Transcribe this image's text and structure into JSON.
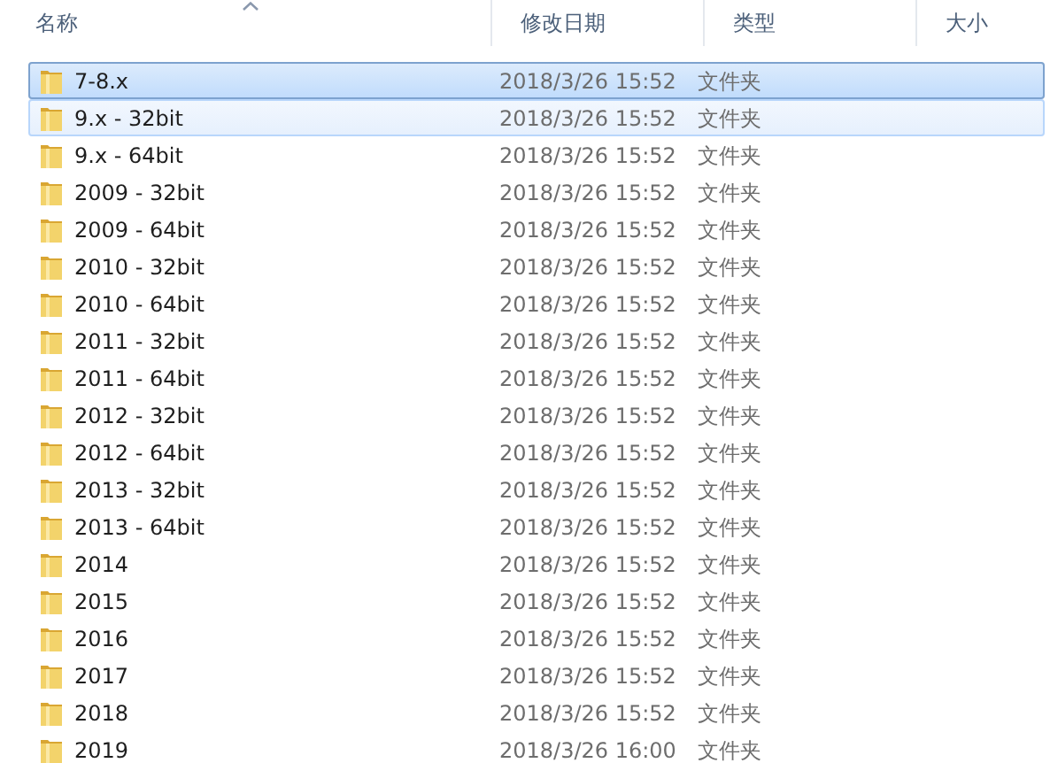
{
  "columns": [
    {
      "label": "名称",
      "sorted": true
    },
    {
      "label": "修改日期",
      "sorted": false
    },
    {
      "label": "类型",
      "sorted": false
    },
    {
      "label": "大小",
      "sorted": false
    }
  ],
  "rows": [
    {
      "name": "7-8.x",
      "date": "2018/3/26 15:52",
      "type": "文件夹",
      "selected": true,
      "hover": false
    },
    {
      "name": "9.x - 32bit",
      "date": "2018/3/26 15:52",
      "type": "文件夹",
      "selected": false,
      "hover": true
    },
    {
      "name": "9.x - 64bit",
      "date": "2018/3/26 15:52",
      "type": "文件夹",
      "selected": false,
      "hover": false
    },
    {
      "name": "2009 - 32bit",
      "date": "2018/3/26 15:52",
      "type": "文件夹",
      "selected": false,
      "hover": false
    },
    {
      "name": "2009 - 64bit",
      "date": "2018/3/26 15:52",
      "type": "文件夹",
      "selected": false,
      "hover": false
    },
    {
      "name": "2010 - 32bit",
      "date": "2018/3/26 15:52",
      "type": "文件夹",
      "selected": false,
      "hover": false
    },
    {
      "name": "2010 - 64bit",
      "date": "2018/3/26 15:52",
      "type": "文件夹",
      "selected": false,
      "hover": false
    },
    {
      "name": "2011 - 32bit",
      "date": "2018/3/26 15:52",
      "type": "文件夹",
      "selected": false,
      "hover": false
    },
    {
      "name": "2011 - 64bit",
      "date": "2018/3/26 15:52",
      "type": "文件夹",
      "selected": false,
      "hover": false
    },
    {
      "name": "2012 - 32bit",
      "date": "2018/3/26 15:52",
      "type": "文件夹",
      "selected": false,
      "hover": false
    },
    {
      "name": "2012 - 64bit",
      "date": "2018/3/26 15:52",
      "type": "文件夹",
      "selected": false,
      "hover": false
    },
    {
      "name": "2013 - 32bit",
      "date": "2018/3/26 15:52",
      "type": "文件夹",
      "selected": false,
      "hover": false
    },
    {
      "name": "2013 - 64bit",
      "date": "2018/3/26 15:52",
      "type": "文件夹",
      "selected": false,
      "hover": false
    },
    {
      "name": "2014",
      "date": "2018/3/26 15:52",
      "type": "文件夹",
      "selected": false,
      "hover": false
    },
    {
      "name": "2015",
      "date": "2018/3/26 15:52",
      "type": "文件夹",
      "selected": false,
      "hover": false
    },
    {
      "name": "2016",
      "date": "2018/3/26 15:52",
      "type": "文件夹",
      "selected": false,
      "hover": false
    },
    {
      "name": "2017",
      "date": "2018/3/26 15:52",
      "type": "文件夹",
      "selected": false,
      "hover": false
    },
    {
      "name": "2018",
      "date": "2018/3/26 15:52",
      "type": "文件夹",
      "selected": false,
      "hover": false
    },
    {
      "name": "2019",
      "date": "2018/3/26 16:00",
      "type": "文件夹",
      "selected": false,
      "hover": false
    }
  ]
}
